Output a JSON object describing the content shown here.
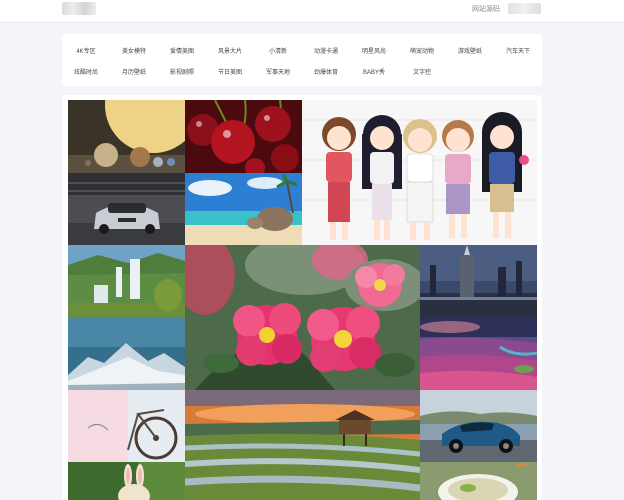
{
  "header": {
    "source_code_link": "网站源码"
  },
  "categories": [
    "4K专区",
    "美女模特",
    "爱情美图",
    "风景大片",
    "小清新",
    "动漫卡通",
    "明星风尚",
    "萌宠动物",
    "游戏壁纸",
    "汽车天下",
    "炫酷时尚",
    "月历壁纸",
    "影视剧照",
    "节日美图",
    "军事天地",
    "劲爆体育",
    "BABY秀",
    "文字控"
  ],
  "gallery_tiles": [
    {
      "id": "planets",
      "icon": "planets-image"
    },
    {
      "id": "cherries",
      "icon": "cherries-image"
    },
    {
      "id": "anime-girls",
      "icon": "anime-girls-image"
    },
    {
      "id": "sports-car-garage",
      "icon": "sports-car-image"
    },
    {
      "id": "tropical-beach",
      "icon": "beach-image"
    },
    {
      "id": "waterfall",
      "icon": "waterfall-image"
    },
    {
      "id": "pink-flowers",
      "icon": "pink-flowers-image"
    },
    {
      "id": "rocket-launch",
      "icon": "rocket-image"
    },
    {
      "id": "snowy-mountains",
      "icon": "mountains-image"
    },
    {
      "id": "flower-field",
      "icon": "flower-field-image"
    },
    {
      "id": "bicycle",
      "icon": "bicycle-image"
    },
    {
      "id": "rice-terraces-hut",
      "icon": "rice-terraces-image"
    },
    {
      "id": "blue-car",
      "icon": "blue-car-image"
    },
    {
      "id": "bunny-toy",
      "icon": "bunny-image"
    },
    {
      "id": "food-bowl",
      "icon": "food-bowl-image"
    }
  ]
}
